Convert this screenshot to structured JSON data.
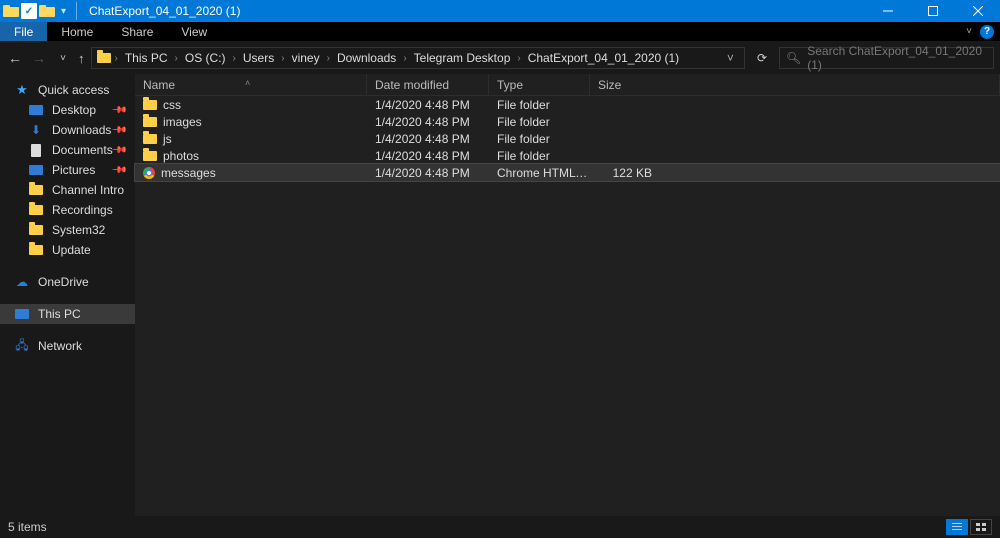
{
  "window": {
    "title": "ChatExport_04_01_2020 (1)"
  },
  "ribbon": {
    "file": "File",
    "tabs": [
      "Home",
      "Share",
      "View"
    ]
  },
  "breadcrumb": {
    "items": [
      "This PC",
      "OS (C:)",
      "Users",
      "viney",
      "Downloads",
      "Telegram Desktop",
      "ChatExport_04_01_2020 (1)"
    ]
  },
  "search": {
    "placeholder": "Search ChatExport_04_01_2020 (1)"
  },
  "sidebar": {
    "quick": "Quick access",
    "quick_items": [
      {
        "icon": "desktop",
        "label": "Desktop",
        "pinned": true
      },
      {
        "icon": "download",
        "label": "Downloads",
        "pinned": true
      },
      {
        "icon": "doc",
        "label": "Documents",
        "pinned": true
      },
      {
        "icon": "pic",
        "label": "Pictures",
        "pinned": true
      },
      {
        "icon": "folder",
        "label": "Channel Intro",
        "pinned": false
      },
      {
        "icon": "folder",
        "label": "Recordings",
        "pinned": false
      },
      {
        "icon": "folder",
        "label": "System32",
        "pinned": false
      },
      {
        "icon": "folder",
        "label": "Update",
        "pinned": false
      }
    ],
    "onedrive": "OneDrive",
    "thispc": "This PC",
    "network": "Network"
  },
  "columns": {
    "name": "Name",
    "date": "Date modified",
    "type": "Type",
    "size": "Size"
  },
  "files": [
    {
      "icon": "folder",
      "name": "css",
      "date": "1/4/2020 4:48 PM",
      "type": "File folder",
      "size": ""
    },
    {
      "icon": "folder",
      "name": "images",
      "date": "1/4/2020 4:48 PM",
      "type": "File folder",
      "size": ""
    },
    {
      "icon": "folder",
      "name": "js",
      "date": "1/4/2020 4:48 PM",
      "type": "File folder",
      "size": ""
    },
    {
      "icon": "folder",
      "name": "photos",
      "date": "1/4/2020 4:48 PM",
      "type": "File folder",
      "size": ""
    },
    {
      "icon": "chrome",
      "name": "messages",
      "date": "1/4/2020 4:48 PM",
      "type": "Chrome HTML Docu…",
      "size": "122 KB",
      "selected": true
    }
  ],
  "status": {
    "text": "5 items"
  }
}
